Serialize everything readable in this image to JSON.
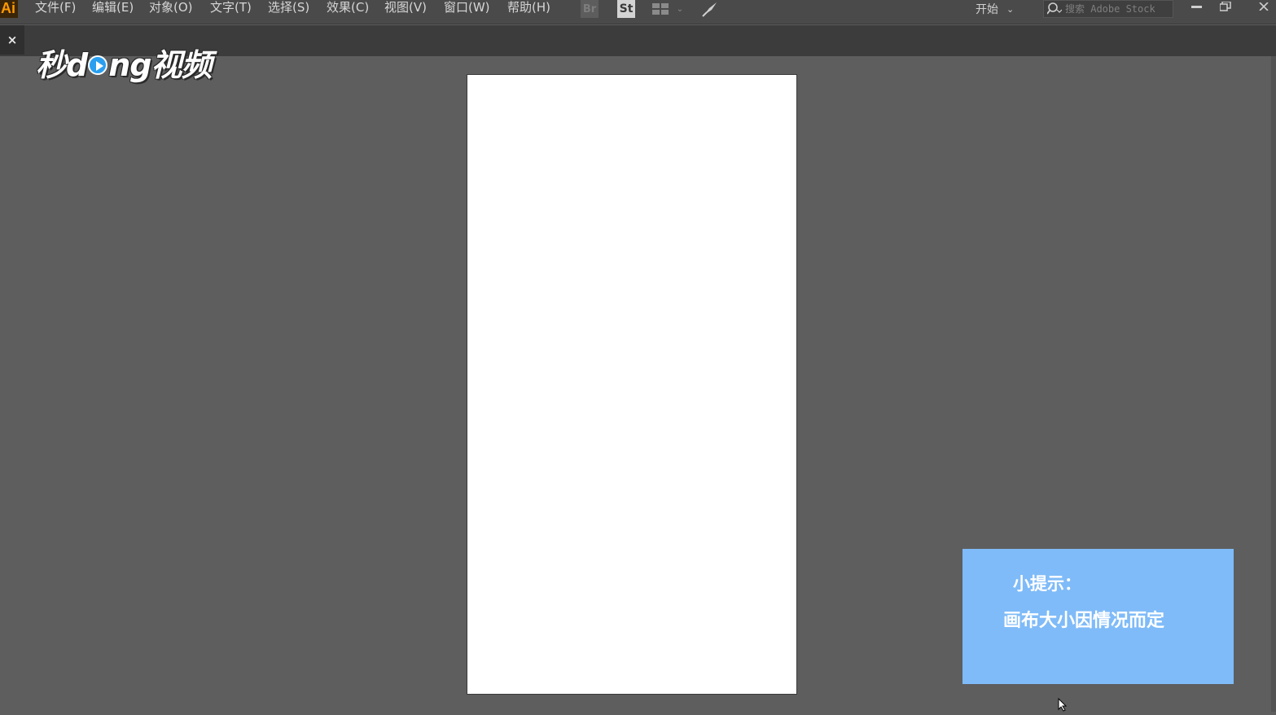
{
  "app": {
    "logo": "Ai",
    "accent_color": "#ff9a00"
  },
  "menu": [
    {
      "label": "文件(F)"
    },
    {
      "label": "编辑(E)"
    },
    {
      "label": "对象(O)"
    },
    {
      "label": "文字(T)"
    },
    {
      "label": "选择(S)"
    },
    {
      "label": "效果(C)"
    },
    {
      "label": "视图(V)"
    },
    {
      "label": "窗口(W)"
    },
    {
      "label": "帮助(H)"
    }
  ],
  "toolbar": {
    "bridge_label": "Br",
    "stock_label": "St",
    "arrange_icon": "arrange-documents-icon",
    "gpu_icon": "rocket-icon"
  },
  "workspace": {
    "label": "开始"
  },
  "search": {
    "placeholder": "搜索 Adobe Stock"
  },
  "document_tab": {
    "close_label": "×"
  },
  "watermark": {
    "text_pre": "秒d",
    "text_post": "ng视频"
  },
  "artboard": {
    "fill": "#ffffff"
  },
  "tip": {
    "title": "小提示：",
    "text": "画布大小因情况而定",
    "background": "#7fbbf8"
  }
}
